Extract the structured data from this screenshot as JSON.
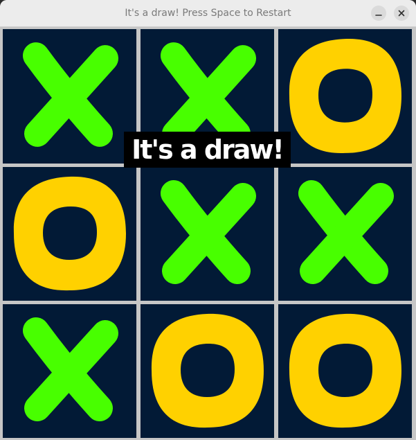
{
  "window": {
    "title": "It's a draw! Press Space to Restart",
    "minimize_icon": "minimize-icon",
    "close_icon": "close-icon"
  },
  "game": {
    "board": [
      [
        "X",
        "X",
        "O"
      ],
      [
        "O",
        "X",
        "X"
      ],
      [
        "X",
        "O",
        "O"
      ]
    ],
    "result_text": "It's a draw!"
  },
  "colors": {
    "x_mark": "#48ff00",
    "o_mark": "#ffd100",
    "cell_background": "#021a36",
    "grid_lines": "#c6c6c6",
    "banner_background": "#000000",
    "banner_text": "#ffffff"
  }
}
